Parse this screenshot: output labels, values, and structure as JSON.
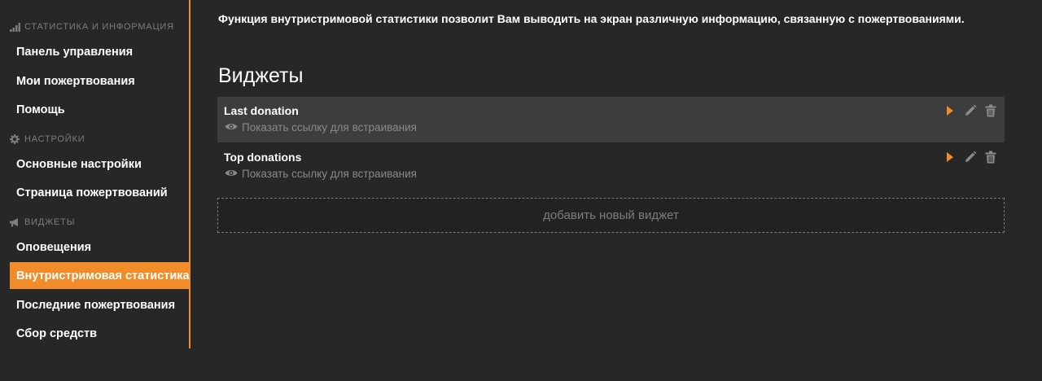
{
  "sidebar": {
    "sections": [
      {
        "title": "СТАТИСТИКА И ИНФОРМАЦИЯ",
        "icon": "signal-bars-icon"
      },
      {
        "title": "НАСТРОЙКИ",
        "icon": "gear-icon"
      },
      {
        "title": "ВИДЖЕТЫ",
        "icon": "megaphone-icon"
      }
    ],
    "items": [
      {
        "label": "Панель управления"
      },
      {
        "label": "Мои пожертвования"
      },
      {
        "label": "Помощь"
      },
      {
        "label": "Основные настройки"
      },
      {
        "label": "Страница пожертвований"
      },
      {
        "label": "Оповещения"
      },
      {
        "label": "Внутристримовая статистика",
        "active": true
      },
      {
        "label": "Последние пожертвования"
      },
      {
        "label": "Сбор средств"
      }
    ]
  },
  "main": {
    "intro": "Функция внутристримовой статистики позволит Вам выводить на экран различную информацию, связанную с пожертвованиями.",
    "title": "Виджеты",
    "widgets": [
      {
        "name": "Last donation",
        "link_label": "Показать ссылку для встраивания"
      },
      {
        "name": "Top donations",
        "link_label": "Показать ссылку для встраивания"
      }
    ],
    "add_widget_label": "добавить новый виджет"
  },
  "colors": {
    "accent": "#f28c28",
    "background": "#272727",
    "row_hover": "#3d3d3d",
    "muted_text": "#8a8a8a"
  }
}
